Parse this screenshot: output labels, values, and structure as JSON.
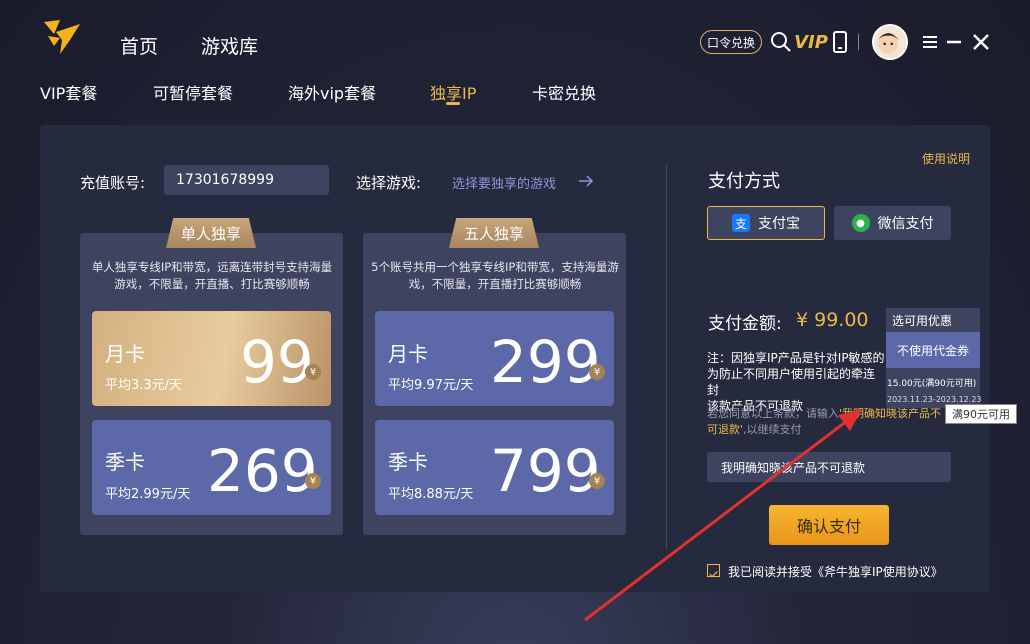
{
  "header": {
    "nav": [
      "首页",
      "游戏库"
    ],
    "command_btn": "口令兑换",
    "vip_icon_text": "VIP"
  },
  "tabs": [
    "VIP套餐",
    "可暂停套餐",
    "海外vip套餐",
    "独享IP",
    "卡密兑换"
  ],
  "form": {
    "account_label": "充值账号:",
    "account_value": "17301678999",
    "game_label": "选择游戏:",
    "game_link": "选择要独享的游戏"
  },
  "cards": [
    {
      "badge": "单人独享",
      "desc": "单人独享专线IP和带宽，远离连带封号支持海量游戏，不限量，开直播、打比赛够顺畅",
      "plans": [
        {
          "name": "月卡",
          "sub": "平均3.3元/天",
          "price": "99"
        },
        {
          "name": "季卡",
          "sub": "平均2.99元/天",
          "price": "269"
        }
      ]
    },
    {
      "badge": "五人独享",
      "desc": "5个账号共用一个独享专线IP和带宽，支持海量游戏，不限量，开直播打比赛够顺畅",
      "plans": [
        {
          "name": "月卡",
          "sub": "平均9.97元/天",
          "price": "299"
        },
        {
          "name": "季卡",
          "sub": "平均8.88元/天",
          "price": "799"
        }
      ]
    }
  ],
  "payment": {
    "help": "使用说明",
    "title": "支付方式",
    "alipay": "支付宝",
    "wechat": "微信支付",
    "amount_label": "支付金额:",
    "amount_value": "¥ 99.00",
    "coupon_select": "选可用优惠",
    "coupon_none": "不使用代金券",
    "coupon_opt_amount": "15.00元(满90元可用)",
    "coupon_opt_date": "2023.11.23-2023.12.23",
    "note_line1": "注：因独享IP产品是针对IP敏感的",
    "note_line2": "为防止不同用户使用引起的牵连封",
    "note_line3": "该款产品不可退款",
    "gray_line_a": "若您同意以上条款，请输入",
    "gray_line_gold1": "'我明确知晓该产品不",
    "gray_line_gold2": "可退款'",
    "gray_line_b": ",以继续支付",
    "confirm_input": "我明确知晓该产品不可退款",
    "confirm_btn": "确认支付",
    "agree": "我已阅读并接受《斧牛独享IP使用协议》",
    "tooltip": "满90元可用"
  },
  "colors": {
    "accent": "#e9b84a",
    "plan_blue": "#5c68a8",
    "red_arrow": "#e2322e"
  }
}
